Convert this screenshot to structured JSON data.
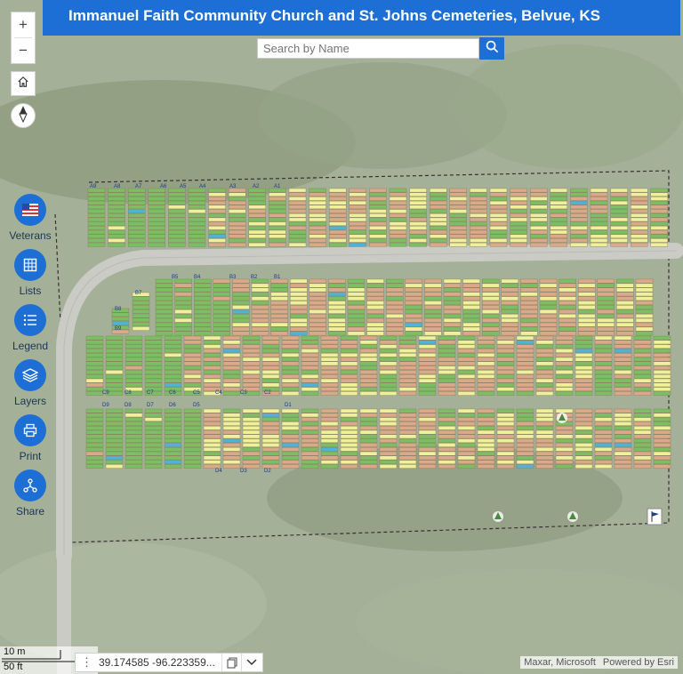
{
  "header": {
    "title": "Immanuel Faith Community Church and St. Johns Cemeteries, Belvue, KS"
  },
  "search": {
    "placeholder": "Search by Name"
  },
  "zoom": {
    "in_label": "+",
    "out_label": "−"
  },
  "tools": [
    {
      "label": "Veterans",
      "icon": "flag-icon"
    },
    {
      "label": "Lists",
      "icon": "table-icon"
    },
    {
      "label": "Legend",
      "icon": "list-icon"
    },
    {
      "label": "Layers",
      "icon": "layers-icon"
    },
    {
      "label": "Print",
      "icon": "printer-icon"
    },
    {
      "label": "Share",
      "icon": "share-icon"
    }
  ],
  "scalebar": {
    "metric": "10 m",
    "imperial": "50 ft"
  },
  "coordinates": {
    "text": "39.174585 -96.223359..."
  },
  "attribution": {
    "imagery": "Maxar, Microsoft",
    "powered": "Powered by Esri"
  },
  "colors": {
    "accent": "#1d6fd6",
    "plot_green": "#7cbf63",
    "plot_yellow": "#eef09a",
    "plot_tan": "#d9a98a",
    "plot_blue": "#4fb2d8"
  },
  "map": {
    "row_labels": [
      "A9",
      "A8",
      "A7",
      "A6",
      "A5",
      "A4",
      "A3",
      "A2",
      "A1",
      "B5",
      "B4",
      "B3",
      "B2",
      "B1",
      "B7",
      "B8",
      "B9",
      "C9",
      "C8",
      "C7",
      "C6",
      "C5",
      "C4",
      "C3",
      "C2",
      "D9",
      "D8",
      "D7",
      "D6",
      "D5",
      "D4",
      "D3",
      "D2",
      "D1"
    ]
  }
}
